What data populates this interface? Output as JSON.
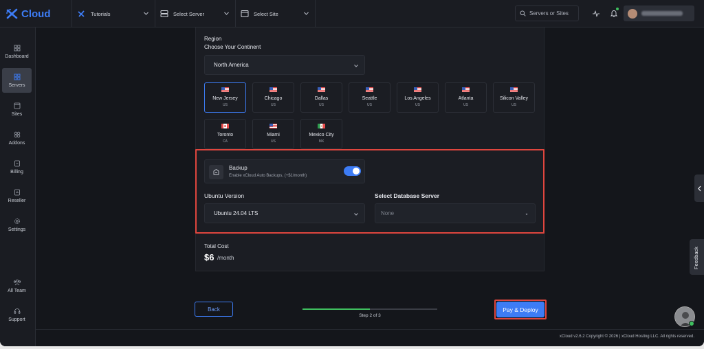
{
  "app": {
    "logo_text": "Cloud",
    "brand_color": "#3d7cf5"
  },
  "topbar": {
    "tutorials": "Tutorials",
    "select_server": "Select Server",
    "select_site": "Select Site",
    "search_placeholder": "Servers or Sites"
  },
  "sidebar": {
    "items": [
      {
        "label": "Dashboard",
        "icon": "dashboard-icon"
      },
      {
        "label": "Servers",
        "icon": "servers-icon",
        "active": true
      },
      {
        "label": "Sites",
        "icon": "sites-icon"
      },
      {
        "label": "Addons",
        "icon": "addons-icon"
      },
      {
        "label": "Billing",
        "icon": "billing-icon"
      },
      {
        "label": "Reseller",
        "icon": "reseller-icon"
      },
      {
        "label": "Settings",
        "icon": "gear-icon"
      },
      {
        "label": "All Team",
        "icon": "team-icon"
      },
      {
        "label": "Support",
        "icon": "headset-icon"
      }
    ]
  },
  "form": {
    "region_label": "Region",
    "continent_label": "Choose Your Continent",
    "continent_value": "North America",
    "regions": [
      {
        "city": "New Jersey",
        "country": "US",
        "selected": true
      },
      {
        "city": "Chicago",
        "country": "US"
      },
      {
        "city": "Dallas",
        "country": "US"
      },
      {
        "city": "Seattle",
        "country": "US"
      },
      {
        "city": "Los Angeles",
        "country": "US"
      },
      {
        "city": "Atlanta",
        "country": "US"
      },
      {
        "city": "Silicon Valley",
        "country": "US"
      },
      {
        "city": "Toronto",
        "country": "CA"
      },
      {
        "city": "Miami",
        "country": "US"
      },
      {
        "city": "Mexico City",
        "country": "MX"
      }
    ],
    "backup_title": "Backup",
    "backup_sub": "Enable xCloud Auto Backups, (+$1/month)",
    "backup_enabled": true,
    "ubuntu_label": "Ubuntu Version",
    "ubuntu_value": "Ubuntu 24.04 LTS",
    "db_label": "Select Database Server",
    "db_value": "None",
    "total_cost_label": "Total Cost",
    "total_cost_value": "$6",
    "total_cost_unit": "/month"
  },
  "footer": {
    "back": "Back",
    "step": "Step 2 of 3",
    "progress": 0.5,
    "pay": "Pay & Deploy",
    "copyright": "xCloud v2.6.2 Copyright © 2026 | xCloud Hosting LLC. All rights reserved."
  },
  "right_rail": {
    "feedback": "Feedback"
  }
}
